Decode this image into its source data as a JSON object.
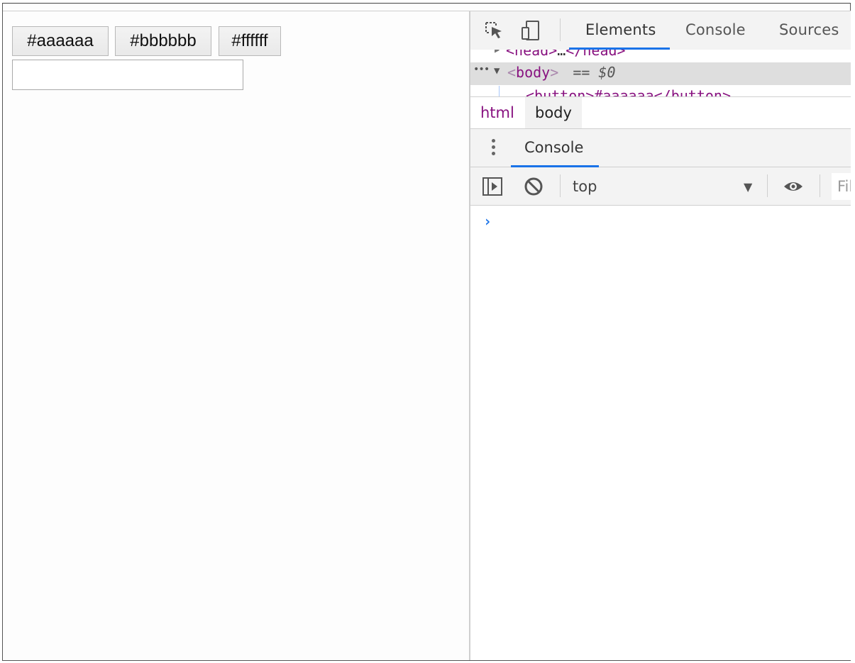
{
  "page": {
    "buttons": [
      "#aaaaaa",
      "#bbbbbb",
      "#ffffff"
    ],
    "text_input_value": ""
  },
  "devtools": {
    "tabs": [
      "Elements",
      "Console",
      "Sources"
    ],
    "active_tab": "Elements",
    "dom_head_line": {
      "open": "<head>",
      "ellipsis": "…",
      "close": "</head>"
    },
    "dom_body_line": {
      "dots": "•••",
      "tag_open": "<",
      "tag_name": "body",
      "tag_close": ">",
      "suffix": "== $0"
    },
    "dom_button_line": {
      "text": "<button>#aaaaaa</button>"
    },
    "breadcrumbs": [
      "html",
      "body"
    ],
    "drawer_tab": "Console",
    "console_context": "top",
    "filter_placeholder": "Filter",
    "prompt_symbol": "›"
  },
  "colors": {
    "accent": "#1a73e8",
    "tag": "#881280"
  }
}
